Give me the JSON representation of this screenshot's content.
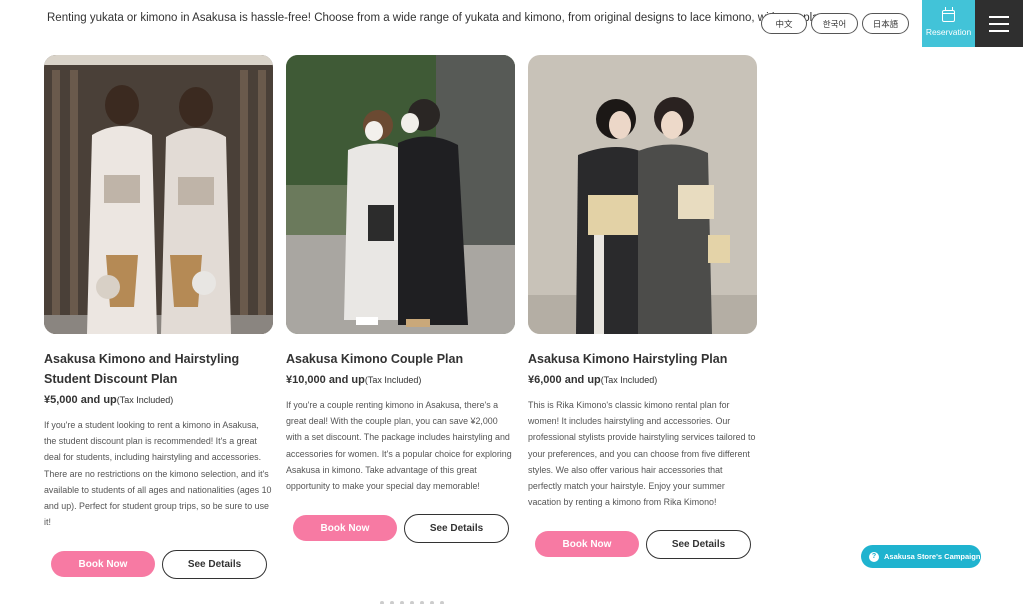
{
  "header": {
    "intro_text": "Renting yukata or kimono in Asakusa is hassle-free! Choose from a wide range of yukata and kimono, from original designs to lace kimono, with any plan.",
    "languages": [
      "中文",
      "한국어",
      "日本語"
    ],
    "reservation_label": "Reservation",
    "reservation_icon": "calendar-icon",
    "menu_icon": "hamburger-menu-icon",
    "accent_color": "#42c3d8"
  },
  "plans": [
    {
      "title_line1": "Asakusa Kimono and Hairstyling",
      "title_line2": "Student Discount Plan",
      "price": "¥5,000 and up",
      "tax": "(Tax Included)",
      "description": "If you're a student looking to rent a kimono in Asakusa, the student discount plan is recommended! It's a great deal for students, including hairstyling and accessories. There are no restrictions on the kimono selection, and it's available to students of all ages and nationalities (ages 10 and up). Perfect for student group trips, so be sure to use it!",
      "book_label": "Book Now",
      "details_label": "See Details"
    },
    {
      "title_line1": "Asakusa Kimono Couple Plan",
      "title_line2": "",
      "price": "¥10,000 and up",
      "tax": "(Tax Included)",
      "description": "If you're a couple renting kimono in Asakusa, there's a great deal! With the couple plan, you can save ¥2,000 with a set discount. The package includes hairstyling and accessories for women. It's a popular choice for exploring Asakusa in kimono. Take advantage of this great opportunity to make your special day memorable!",
      "book_label": "Book Now",
      "details_label": "See Details"
    },
    {
      "title_line1": "Asakusa Kimono Hairstyling Plan",
      "title_line2": "",
      "price": "¥6,000 and up",
      "tax": "(Tax Included)",
      "description": "This is Rika Kimono's classic kimono rental plan for women! It includes hairstyling and accessories. Our professional stylists provide hairstyling services tailored to your preferences, and you can choose from five different styles. We also offer various hair accessories that perfectly match your hairstyle. Enjoy your summer vacation by renting a kimono from Rika Kimono!",
      "book_label": "Book Now",
      "details_label": "See Details"
    }
  ],
  "campaign_label": "Asakusa Store's Campaign",
  "book_button_color": "#f77aa3"
}
